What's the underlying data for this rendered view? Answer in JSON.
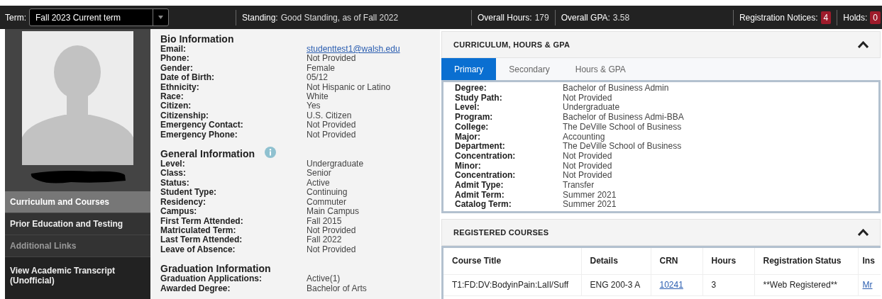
{
  "top_bar": {
    "term_label": "Term:",
    "term_value": "Fall 2023 Current term",
    "standing_label": "Standing:",
    "standing_value": "Good Standing, as of Fall 2022",
    "hours_label": "Overall Hours:",
    "hours_value": "179",
    "gpa_label": "Overall GPA:",
    "gpa_value": "3.58",
    "notices_label": "Registration Notices:",
    "notices_count": "4",
    "holds_label": "Holds:",
    "holds_count": "0"
  },
  "sidebar": {
    "items": [
      {
        "label": "Curriculum and Courses",
        "kind": "nav",
        "selected": true,
        "disabled": false
      },
      {
        "label": "Prior Education and Testing",
        "kind": "nav",
        "selected": false,
        "disabled": false
      },
      {
        "label": "Additional Links",
        "kind": "nav",
        "selected": false,
        "disabled": true
      },
      {
        "label": "View Academic Transcript (Unofficial)",
        "kind": "action",
        "selected": false,
        "disabled": false
      }
    ]
  },
  "sections": [
    {
      "title": "Bio Information",
      "rows": [
        {
          "label": "Email:",
          "value": "studenttest1@walsh.edu",
          "kind": "link"
        },
        {
          "label": "Phone:",
          "value": "Not Provided",
          "kind": "text"
        },
        {
          "label": "Gender:",
          "value": "Female",
          "kind": "text"
        },
        {
          "label": "Date of Birth:",
          "value": "05/12",
          "kind": "text"
        },
        {
          "label": "Ethnicity:",
          "value": "Not Hispanic or Latino",
          "kind": "text"
        },
        {
          "label": "Race:",
          "value": "White",
          "kind": "text"
        },
        {
          "label": "Citizen:",
          "value": "Yes",
          "kind": "text"
        },
        {
          "label": "Citizenship:",
          "value": "U.S. Citizen",
          "kind": "text"
        },
        {
          "label": "Emergency Contact:",
          "value": "Not Provided",
          "kind": "text"
        },
        {
          "label": "Emergency Phone:",
          "value": "Not Provided",
          "kind": "text"
        }
      ]
    },
    {
      "title": "General Information",
      "info": true,
      "rows": [
        {
          "label": "Level:",
          "value": "Undergraduate",
          "kind": "text"
        },
        {
          "label": "Class:",
          "value": "Senior",
          "kind": "text"
        },
        {
          "label": "Status:",
          "value": "Active",
          "kind": "text"
        },
        {
          "label": "Student Type:",
          "value": "Continuing",
          "kind": "text"
        },
        {
          "label": "Residency:",
          "value": "Commuter",
          "kind": "text"
        },
        {
          "label": "Campus:",
          "value": "Main Campus",
          "kind": "text"
        },
        {
          "label": "First Term Attended:",
          "value": "Fall 2015",
          "kind": "text"
        },
        {
          "label": "Matriculated Term:",
          "value": "Not Provided",
          "kind": "text"
        },
        {
          "label": "Last Term Attended:",
          "value": "Fall 2022",
          "kind": "text"
        },
        {
          "label": "Leave of Absence:",
          "value": "Not Provided",
          "kind": "text"
        }
      ]
    },
    {
      "title": "Graduation Information",
      "rows": [
        {
          "label": "Graduation Applications:",
          "value": "Active(1)",
          "kind": "text"
        },
        {
          "label": "Awarded Degree:",
          "value": "Bachelor of Arts",
          "kind": "text"
        }
      ]
    }
  ],
  "curriculum_panel": {
    "title": "CURRICULUM, HOURS & GPA",
    "expanded": true,
    "tabs": [
      {
        "label": "Primary",
        "selected": true
      },
      {
        "label": "Secondary",
        "selected": false
      },
      {
        "label": "Hours & GPA",
        "selected": false
      }
    ],
    "rows": [
      {
        "label": "Degree:",
        "value": "Bachelor of Business Admin"
      },
      {
        "label": "Study Path:",
        "value": "Not Provided"
      },
      {
        "label": "Level:",
        "value": "Undergraduate"
      },
      {
        "label": "Program:",
        "value": "Bachelor of Business Admi-BBA"
      },
      {
        "label": "College:",
        "value": "The DeVille School of Business"
      },
      {
        "label": "Major:",
        "value": "Accounting"
      },
      {
        "label": "Department:",
        "value": "The DeVille School of Business"
      },
      {
        "label": "Concentration:",
        "value": "Not Provided"
      },
      {
        "label": "Minor:",
        "value": "Not Provided"
      },
      {
        "label": "Concentration:",
        "value": "Not Provided"
      },
      {
        "label": "Admit Type:",
        "value": "Transfer"
      },
      {
        "label": "Admit Term:",
        "value": "Summer 2021"
      },
      {
        "label": "Catalog Term:",
        "value": "Summer 2021"
      }
    ]
  },
  "courses_panel": {
    "title": "REGISTERED COURSES",
    "expanded": true,
    "columns": [
      "Course Title",
      "Details",
      "CRN",
      "Hours",
      "Registration Status",
      "Ins"
    ],
    "rows": [
      {
        "cells": [
          {
            "text": "T1:FD:DV:BodyinPain:LaIl/Suff",
            "kind": "text"
          },
          {
            "text": "ENG 200-3 A",
            "kind": "text"
          },
          {
            "text": "10241",
            "kind": "link"
          },
          {
            "text": "3",
            "kind": "text"
          },
          {
            "text": "**Web Registered**",
            "kind": "text"
          },
          {
            "text": "Mr",
            "kind": "link"
          }
        ]
      }
    ]
  }
}
